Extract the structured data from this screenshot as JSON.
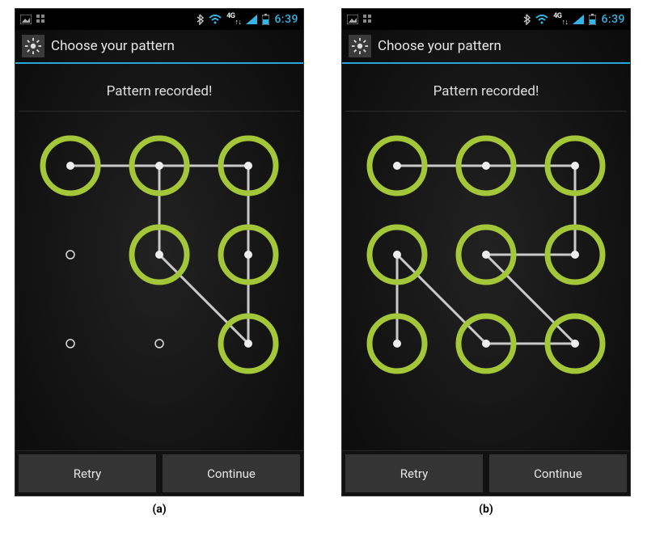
{
  "statusbar": {
    "time": "6:39",
    "network_label": "4G",
    "signal_bars": 4,
    "wifi": true,
    "bluetooth": true
  },
  "titlebar": {
    "title": "Choose your pattern"
  },
  "content": {
    "prompt": "Pattern recorded!"
  },
  "buttons": {
    "retry": "Retry",
    "continue": "Continue"
  },
  "captions": {
    "left": "(a)",
    "right": "(b)"
  },
  "grid": {
    "cols": 3,
    "rows": 3,
    "patterns": {
      "a": {
        "path": [
          0,
          1,
          2,
          5,
          8,
          4,
          1
        ],
        "active_nodes": [
          0,
          1,
          2,
          4,
          5,
          8
        ]
      },
      "b": {
        "path": [
          0,
          1,
          2,
          5,
          4,
          8,
          7,
          3,
          6
        ],
        "active_nodes": [
          0,
          1,
          2,
          3,
          4,
          5,
          6,
          7,
          8
        ]
      }
    }
  },
  "colors": {
    "active_ring": "#a4c639",
    "line": "#c9c9c9",
    "accent": "#33b5e5"
  }
}
